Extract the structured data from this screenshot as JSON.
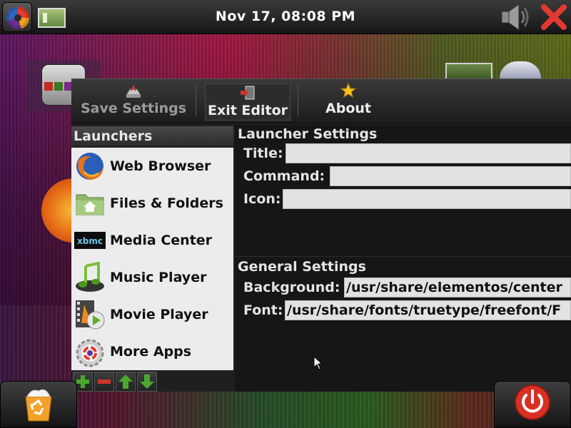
{
  "topbar": {
    "clock": "Nov 17, 08:08 PM",
    "menu_icon": "elementos-swirl-icon",
    "window_icon": "window-thumbnail-icon",
    "volume_icon": "speaker-icon",
    "close_icon": "close-x-icon"
  },
  "toolbar": {
    "save_label": "Save Settings",
    "exit_label": "Exit Editor",
    "about_label": "About"
  },
  "launchers": {
    "header": "Launchers",
    "items": [
      {
        "label": "Web Browser",
        "icon": "firefox-icon"
      },
      {
        "label": "Files & Folders",
        "icon": "folder-home-icon"
      },
      {
        "label": "Media Center",
        "icon": "xbmc-icon"
      },
      {
        "label": "Music Player",
        "icon": "music-note-icon"
      },
      {
        "label": "Movie Player",
        "icon": "movie-player-icon"
      },
      {
        "label": "More Apps",
        "icon": "more-apps-gear-icon"
      }
    ],
    "buttons": [
      "add-icon",
      "remove-icon",
      "move-up-icon",
      "move-down-icon"
    ]
  },
  "launcher_settings": {
    "title": "Launcher Settings",
    "title_label": "Title:",
    "title_value": "",
    "command_label": "Command:",
    "command_value": "",
    "icon_label": "Icon:",
    "icon_value": ""
  },
  "general_settings": {
    "title": "General Settings",
    "background_label": "Background:",
    "background_value": "/usr/share/elementos/center",
    "font_label": "Font:",
    "font_value": "/usr/share/fonts/truetype/freefont/F"
  },
  "colors": {
    "accent_green": "#3f9a2a",
    "accent_red": "#d0342c",
    "panel_dark": "#1f1f1f",
    "list_bg": "#ececec"
  }
}
